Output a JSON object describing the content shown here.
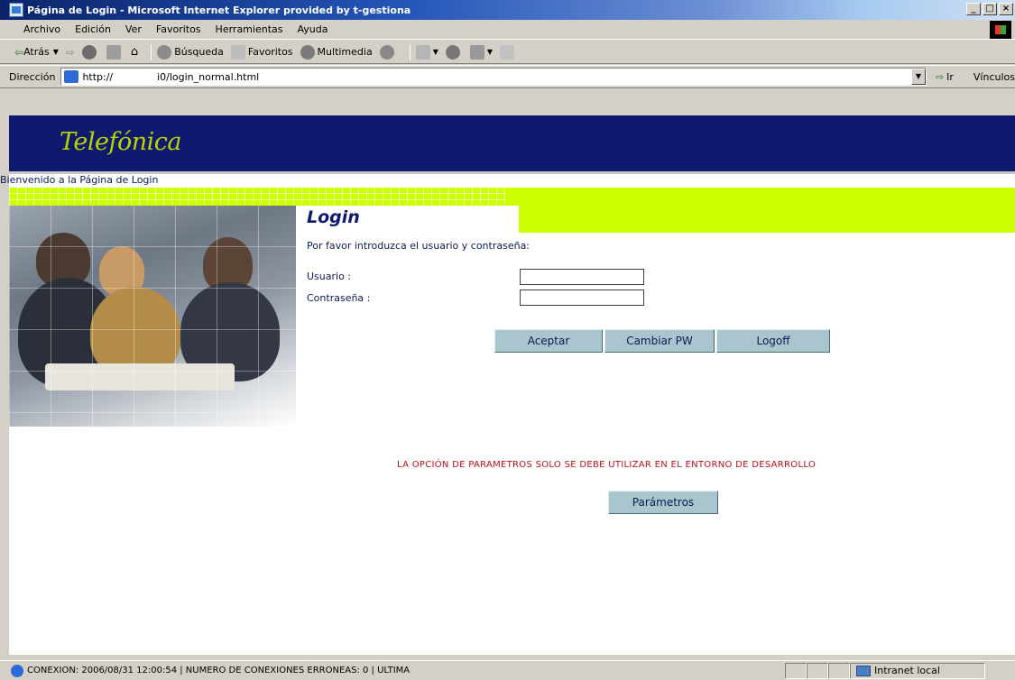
{
  "window": {
    "title": "Página de Login - Microsoft Internet Explorer provided by t-gestiona",
    "buttons": [
      "_",
      "□",
      "×"
    ]
  },
  "menu": [
    "Archivo",
    "Edición",
    "Ver",
    "Favoritos",
    "Herramientas",
    "Ayuda"
  ],
  "toolbar": {
    "back": "Atrás",
    "search": "Búsqueda",
    "favorites": "Favoritos",
    "multimedia": "Multimedia"
  },
  "address": {
    "label": "Dirección",
    "url": "http://              i0/login_normal.html",
    "go": "Ir",
    "links": "Vínculos"
  },
  "page": {
    "logo": "Telefónica",
    "welcome": "Bienvenido a la Página de Login",
    "login_title": "Login",
    "prompt": "Por favor introduzca el usuario y contraseña:",
    "user_label": "Usuario :",
    "password_label": "Contraseña :",
    "btn_accept": "Aceptar",
    "btn_change_pw": "Cambiar PW",
    "btn_logoff": "Logoff",
    "warning": "LA OPCIÓN DE PARAMETROS SOLO SE DEBE UTILIZAR EN EL ENTORNO DE DESARROLLO",
    "btn_params": "Parámetros"
  },
  "status": {
    "text": "CONEXIÓN: 2006/08/31 12:00:54 | NÚMERO DE CONEXIONES ERRONEAS: 0 | ULTIMA",
    "zone": "Intranet local"
  },
  "colors": {
    "brand_navy": "#0f1a6e",
    "brand_lime": "#ccff00",
    "button": "#a9c6cf",
    "warning": "#b80f1c"
  }
}
